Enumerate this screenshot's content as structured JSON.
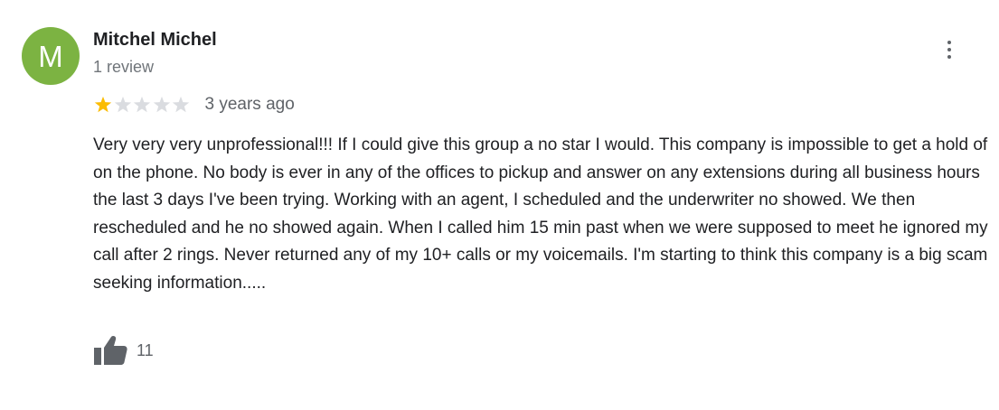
{
  "review": {
    "author": {
      "initial": "M",
      "name": "Mitchel Michel",
      "review_count": "1 review",
      "avatar_color": "#7cb342"
    },
    "rating": 1,
    "rating_max": 5,
    "star_filled_color": "#fbbc04",
    "star_empty_color": "#dadce0",
    "date": "3 years ago",
    "text": "Very very very unprofessional!!! If I could give this group a no star I would. This company is impossible to get a hold of on the phone. No body is ever in any of the offices to pickup and answer on any extensions during all business hours the last 3 days I've been trying. Working with an agent, I scheduled and the underwriter no showed. We then rescheduled and he no showed again. When I called him 15 min past when we were supposed to meet he ignored my call after 2 rings. Never returned any of my 10+ calls or my voicemails. I'm starting to think this company is a big scam seeking information.....",
    "like_count": "11",
    "icons": {
      "more": "more-vert-icon",
      "like": "thumb-up-icon",
      "star": "star-icon"
    }
  }
}
